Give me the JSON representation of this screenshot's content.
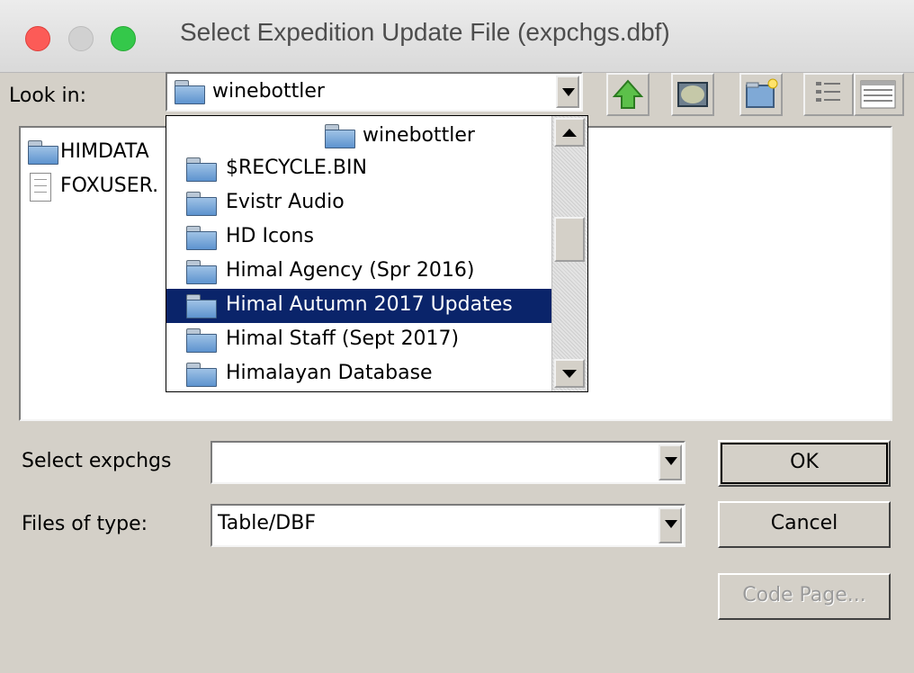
{
  "window": {
    "title": "Select Expedition Update File (expchgs.dbf)"
  },
  "look_in": {
    "label": "Look in:",
    "value": "winebottler"
  },
  "toolbar": {
    "icons": [
      "up-one-level-icon",
      "desktop-icon",
      "new-folder-icon",
      "list-view-icon",
      "details-view-icon"
    ]
  },
  "file_list": [
    {
      "name": "HIMDATA",
      "type": "folder"
    },
    {
      "name": "FOXUSER.",
      "type": "file"
    }
  ],
  "dropdown": {
    "header": "winebottler",
    "items": [
      {
        "name": "$RECYCLE.BIN",
        "selected": false
      },
      {
        "name": "Evistr Audio",
        "selected": false
      },
      {
        "name": "HD Icons",
        "selected": false
      },
      {
        "name": "Himal Agency (Spr 2016)",
        "selected": false
      },
      {
        "name": "Himal Autumn 2017 Updates",
        "selected": true
      },
      {
        "name": "Himal Staff (Sept 2017)",
        "selected": false
      },
      {
        "name": "Himalayan Database",
        "selected": false
      }
    ]
  },
  "select_field": {
    "label": "Select expchgs",
    "value": ""
  },
  "type_field": {
    "label": "Files of type:",
    "value": "Table/DBF"
  },
  "buttons": {
    "ok": "OK",
    "cancel": "Cancel",
    "code_page": "Code Page..."
  },
  "colors": {
    "selection": "#0a246a",
    "dialog_bg": "#d4d0c8"
  }
}
